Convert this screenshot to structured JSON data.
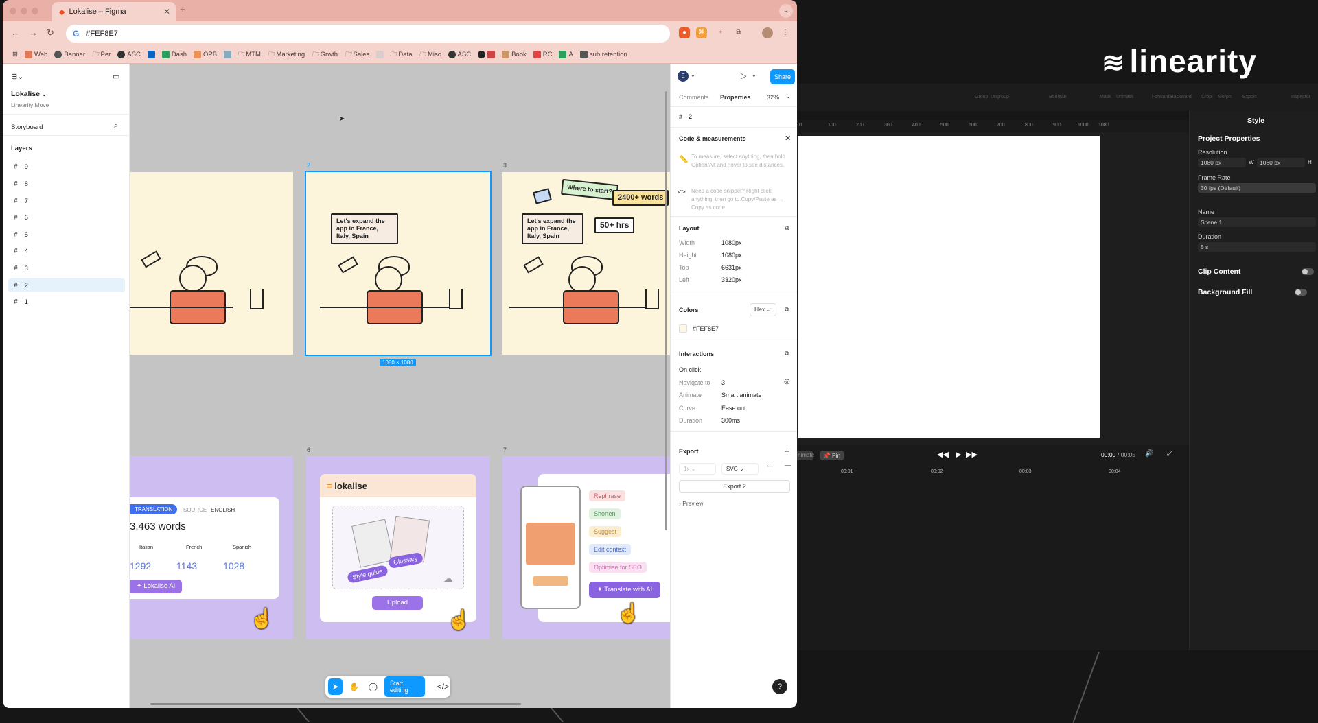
{
  "browser": {
    "tab_title": "Lokalise – Figma",
    "address": "#FEF8E7",
    "bookmarks": [
      "Web",
      "Banner",
      "Per",
      "ASC",
      "in",
      "Dash",
      "OPB",
      "MTM",
      "Marketing",
      "Grwth",
      "Sales",
      "Data",
      "Misc",
      "ASC",
      "Book",
      "RC",
      "A",
      "sub retention"
    ]
  },
  "figma": {
    "file_name": "Lokalise",
    "team": "Linearity Move",
    "page": "Storyboard",
    "layers_heading": "Layers",
    "layers": [
      "9",
      "8",
      "7",
      "6",
      "5",
      "4",
      "3",
      "2",
      "1"
    ],
    "selected_layer": "2",
    "frame_labels": [
      "2",
      "3",
      "6",
      "7"
    ],
    "selection_size": "1080 × 1080",
    "frames": {
      "frame2_bubble": "Let's expand the app in France, Italy, Spain",
      "frame3_bubble1": "Let's expand the app in France, Italy, Spain",
      "frame3_bubble2": "Where to start?",
      "frame3_bubble3": "2400+ words",
      "frame3_bubble4": "50+ hrs",
      "frame5": {
        "tag": "TRANSLATION",
        "source_label": "SOURCE",
        "source_value": "ENGLISH",
        "words": "3,463 words",
        "langs": [
          "Italian",
          "French",
          "Spanish"
        ],
        "counts": [
          "1292",
          "1143",
          "1028"
        ],
        "button": "Lokalise AI"
      },
      "frame6": {
        "logo": "lokalise",
        "glossary": "Glossary",
        "style_guide": "Style guide",
        "upload": "Upload"
      },
      "frame7": {
        "chips": [
          "Rephrase",
          "Shorten",
          "Suggest",
          "Edit context",
          "Optimise for SEO"
        ],
        "button": "Translate with AI"
      }
    },
    "toolbar": {
      "start_editing": "Start editing"
    },
    "right": {
      "avatar": "E",
      "share": "Share",
      "tabs": [
        "Comments",
        "Properties"
      ],
      "zoom": "32%",
      "frame_name": "2",
      "code_heading": "Code & measurements",
      "hint1": "To measure, select anything, then hold Option/Alt and hover to see distances.",
      "hint2": "Need a code snippet? Right click anything, then go to Copy/Paste as → Copy as code",
      "layout_heading": "Layout",
      "layout": [
        {
          "k": "Width",
          "v": "1080px"
        },
        {
          "k": "Height",
          "v": "1080px"
        },
        {
          "k": "Top",
          "v": "6631px"
        },
        {
          "k": "Left",
          "v": "3320px"
        }
      ],
      "colors_heading": "Colors",
      "color_format": "Hex",
      "color_value": "#FEF8E7",
      "interactions_heading": "Interactions",
      "on_click": "On click",
      "interactions": [
        {
          "k": "Navigate to",
          "v": "3"
        },
        {
          "k": "Animate",
          "v": "Smart animate"
        },
        {
          "k": "Curve",
          "v": "Ease out"
        },
        {
          "k": "Duration",
          "v": "300ms"
        }
      ],
      "export_heading": "Export",
      "export_scale": "1x",
      "export_format": "SVG",
      "export_button": "Export 2",
      "preview": "Preview",
      "help": "?"
    }
  },
  "linearity": {
    "logo": "linearity",
    "toolbar": [
      "Group",
      "Ungroup",
      "Boolean",
      "Mask",
      "Unmask",
      "Forward",
      "Backward",
      "Crop",
      "Morph",
      "Export",
      "Inspector"
    ],
    "ruler": [
      "0",
      "100",
      "200",
      "300",
      "400",
      "500",
      "600",
      "700",
      "800",
      "900",
      "1000",
      "1080"
    ],
    "pin": "Pin",
    "nimate": "nimate",
    "time": "00:00",
    "total": "/ 00:05",
    "timeline_marks": [
      "00:01",
      "00:02",
      "00:03",
      "00:04"
    ],
    "style": {
      "title": "Style",
      "project_props": "Project Properties",
      "resolution": "Resolution",
      "width": "1080 px",
      "w": "W",
      "height": "1080 px",
      "h": "H",
      "frame_rate": "Frame Rate",
      "fps": "30 fps (Default)",
      "name_label": "Name",
      "name_value": "Scene 1",
      "duration_label": "Duration",
      "duration_value": "5 s",
      "clip": "Clip Content",
      "bg_fill": "Background Fill"
    }
  },
  "colors": {
    "figma_blue": "#0d99ff",
    "purple": "#9b72e8",
    "cream": "#fdf4dc",
    "lavender": "#cdbdf0",
    "salmon": "#ea7a5a"
  }
}
